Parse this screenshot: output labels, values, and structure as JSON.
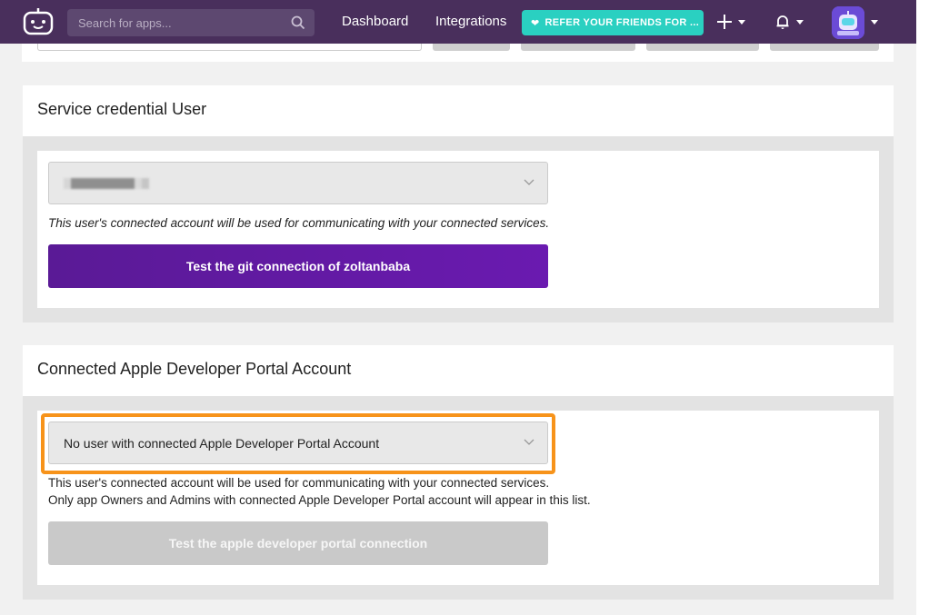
{
  "search": {
    "placeholder": "Search for apps..."
  },
  "nav": {
    "links": [
      "Dashboard",
      "Integrations"
    ],
    "refer_label": "REFER YOUR FRIENDS FOR ..."
  },
  "icons": {
    "logo": "bitrise-bot-icon",
    "search": "search-icon",
    "add": "plus-icon",
    "notifications": "bell-icon",
    "avatar": "user-avatar"
  },
  "colors": {
    "nav_bg": "#492f5c",
    "refer_bg": "#2ad0c1",
    "primary_button": "#5a1a96",
    "highlight": "#f7931a"
  },
  "service_credential": {
    "title": "Service credential User",
    "selected_user": "",
    "hint": "This user's connected account will be used for communicating with your connected services.",
    "button_label": "Test the git connection of zoltanbaba"
  },
  "apple_portal": {
    "title": "Connected Apple Developer Portal Account",
    "selected_value": "No user with connected Apple Developer Portal Account",
    "hint_line1": "This user's connected account will be used for communicating with your connected services.",
    "hint_line2": "Only app Owners and Admins with connected Apple Developer Portal account will appear in this list.",
    "button_label": "Test the apple developer portal connection"
  }
}
